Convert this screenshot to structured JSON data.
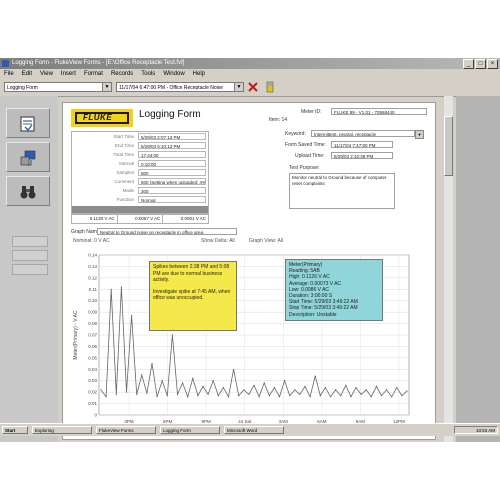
{
  "window": {
    "title": "Logging Form - FlukeView Forms - [E:\\Office Receptacle Test.fvf]",
    "menu": [
      "File",
      "Edit",
      "View",
      "Insert",
      "Format",
      "Records",
      "Tools",
      "Window",
      "Help"
    ]
  },
  "toolbar": {
    "form_selector": "Logging Form",
    "record_selector": "11/17/04 6:47:00 PM - Office Receptacle Noise"
  },
  "form": {
    "brand": "FLUKE",
    "title": "Logging Form",
    "meter_id_label": "Meter ID:",
    "meter_id_value": "FLUKE 89 - V1.01 - 70568440",
    "item_label": "Item: 14",
    "keyword_label": "Keyword:",
    "keyword_value": "Intermittent, neutral, receptacle",
    "form_saved_label": "Form Saved Time:",
    "form_saved_value": "11/17/04 7:47:00 PM",
    "upload_label": "Upload Time:",
    "upload_value": "5/29/03 2:10:39 PM",
    "test_purpose_label": "Test Purpose:",
    "test_purpose_value": "Monitor neutral to Ground because of computer reset complaints",
    "info_rows": [
      {
        "label": "Start Time",
        "value": "5/29/03 2:07:13 PM"
      },
      {
        "label": "End Time",
        "value": "5/29/03 6:10:13 PM"
      },
      {
        "label": "Total Time",
        "value": "17:44:00"
      },
      {
        "label": "Interval",
        "value": "0:10:00"
      },
      {
        "label": "Samples",
        "value": "800"
      },
      {
        "label": "Comment",
        "value": "500 (Setting when uploaded: 4%)"
      },
      {
        "label": "Mode",
        "value": "300"
      },
      {
        "label": "Function",
        "value": "Normal"
      }
    ],
    "summary_values": [
      "0.1130 V AC",
      "0.0057 V AC",
      "0.0001 V AC"
    ],
    "graph_name_label": "Graph Name:",
    "graph_name_value": "Neutral to Ground noise on receptacle in office area.",
    "graph_subheader": [
      "Nominal: 0 V AC",
      "Show Delta: All",
      "Graph View: All"
    ]
  },
  "annotations": {
    "yellow": [
      "Spikes between 2:38 PM and 5:08 PM are due to normal business activity.",
      "Investigate spike at 7:45 AM, when office was unoccupied."
    ],
    "cyan": [
      "Meter(Primary)",
      "Reading: 5AB",
      "High: 0.1126 V AC",
      "Average: 0.00073 V AC",
      "Low: 0.0086 V AC",
      "Duration: 3:00:00 S",
      "Start Time: 5/29/03 3:49:22 AM",
      "Stop Time: 5/29/03 3:49:22 AM",
      "Description: Unstable"
    ]
  },
  "chart_data": {
    "type": "line",
    "ylabel": "Meter(Primary) - V AC",
    "y_ticks": [
      "0.14",
      "0.13",
      "0.12",
      "0.11",
      "0.10",
      "0.09",
      "0.08",
      "0.07",
      "0.06",
      "0.05",
      "0.04",
      "0.03",
      "0.02",
      "0.01",
      "0"
    ],
    "ylim": [
      0,
      0.14
    ],
    "x_ticks": [
      "3PM",
      "6PM",
      "9PM",
      "24 Sat",
      "3AM",
      "6AM",
      "9AM",
      "12PM"
    ],
    "grid": true,
    "series": [
      {
        "color": "#666666",
        "x": [
          0,
          1,
          2,
          3,
          4,
          5,
          6,
          7,
          8,
          9,
          10,
          11,
          12,
          13,
          14,
          15,
          16,
          17,
          18,
          19,
          20,
          21,
          22,
          23,
          24,
          25,
          26,
          27,
          28,
          29,
          30,
          31,
          32,
          33,
          34,
          35,
          36,
          37,
          38,
          39,
          40,
          41,
          42,
          43,
          44,
          45,
          46,
          47,
          48,
          49,
          50,
          51,
          52,
          53,
          54,
          55,
          56,
          57,
          58,
          59,
          60
        ],
        "values": [
          0.022,
          0.016,
          0.11,
          0.018,
          0.112,
          0.02,
          0.087,
          0.018,
          0.035,
          0.019,
          0.045,
          0.016,
          0.03,
          0.017,
          0.07,
          0.018,
          0.028,
          0.016,
          0.032,
          0.017,
          0.025,
          0.018,
          0.03,
          0.017,
          0.024,
          0.016,
          0.04,
          0.017,
          0.022,
          0.018,
          0.026,
          0.016,
          0.028,
          0.017,
          0.024,
          0.016,
          0.03,
          0.017,
          0.022,
          0.018,
          0.025,
          0.016,
          0.034,
          0.017,
          0.024,
          0.016,
          0.022,
          0.017,
          0.026,
          0.016,
          0.024,
          0.018,
          0.022,
          0.016,
          0.025,
          0.017,
          0.022,
          0.016,
          0.024,
          0.017,
          0.021
        ]
      }
    ]
  },
  "sidebar": {
    "buttons": [
      "form-view-icon",
      "edit-data-icon",
      "binoculars-icon"
    ]
  },
  "taskbar": {
    "start_label": "Start",
    "clock": "10:53 AM",
    "tasks": [
      "Exploring",
      "FlukeView Forms",
      "Logging Form",
      "Microsoft Word"
    ]
  }
}
